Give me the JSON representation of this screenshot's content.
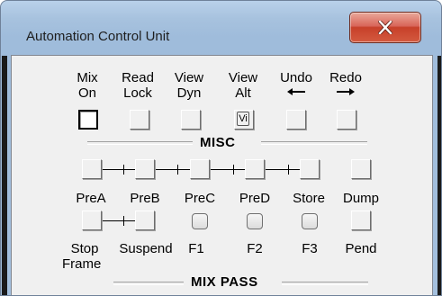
{
  "window": {
    "title": "Automation Control Unit",
    "close_glyph": "X",
    "accent_color": "#c7402a"
  },
  "misc": {
    "section_title": "MISC",
    "top_row": [
      {
        "line1": "Mix",
        "line2": "On",
        "state": "checked"
      },
      {
        "line1": "Read",
        "line2": "Lock",
        "state": "unchecked"
      },
      {
        "line1": "View",
        "line2": "Dyn",
        "state": "unchecked"
      },
      {
        "line1": "View",
        "line2": "Alt",
        "state": "vi",
        "badge": "Vi"
      },
      {
        "line1": "Undo",
        "line2": "",
        "icon": "arrow-left-icon",
        "state": "unchecked"
      },
      {
        "line1": "Redo",
        "line2": "",
        "icon": "arrow-right-icon",
        "state": "unchecked"
      }
    ]
  },
  "pass_row": {
    "labels": [
      "PreA",
      "PreB",
      "PreC",
      "PreD",
      "Store",
      "Dump"
    ]
  },
  "bottom_row": {
    "labels": [
      "Stop",
      "Suspend",
      "F1",
      "F2",
      "F3",
      "Pend"
    ],
    "stop_line2": "Frame"
  },
  "mix_pass": {
    "section_title": "MIX PASS"
  }
}
